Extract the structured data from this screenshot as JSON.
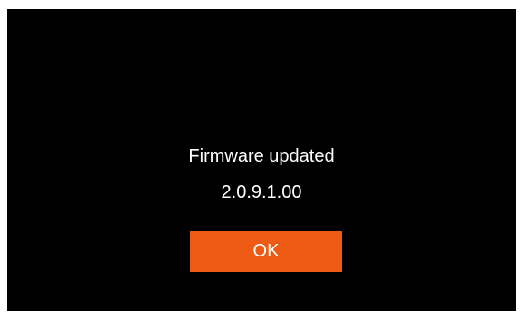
{
  "dialog": {
    "title": "Firmware updated",
    "version": "2.0.9.1.00",
    "ok_label": "OK"
  },
  "colors": {
    "screen_background": "#000000",
    "text": "#ffffff",
    "accent": "#ec5a13"
  }
}
